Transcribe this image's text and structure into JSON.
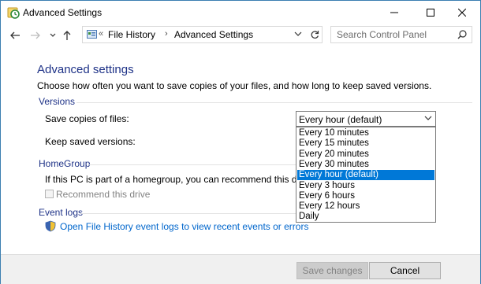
{
  "window": {
    "title": "Advanced Settings"
  },
  "address": {
    "crumbs": [
      "File History",
      "Advanced Settings"
    ],
    "overflow": "«",
    "separator": "›"
  },
  "search": {
    "placeholder": "Search Control Panel"
  },
  "main": {
    "heading": "Advanced settings",
    "description": "Choose how often you want to save copies of your files, and how long to keep saved versions.",
    "versions": {
      "group_label": "Versions",
      "save_copies_label": "Save copies of files:",
      "keep_versions_label": "Keep saved versions:",
      "save_copies_value": "Every hour (default)",
      "options": [
        "Every 10 minutes",
        "Every 15 minutes",
        "Every 20 minutes",
        "Every 30 minutes",
        "Every hour (default)",
        "Every 3 hours",
        "Every 6 hours",
        "Every 12 hours",
        "Daily"
      ],
      "selected_index": 4
    },
    "homegroup": {
      "group_label": "HomeGroup",
      "text": "If this PC is part of a homegroup, you can recommend this drive to",
      "checkbox_label": "Recommend this drive",
      "checked": false
    },
    "eventlogs": {
      "group_label": "Event logs",
      "link": "Open File History event logs to view recent events or errors"
    }
  },
  "footer": {
    "save_label": "Save changes",
    "cancel_label": "Cancel"
  },
  "colors": {
    "heading": "#1e3287",
    "link": "#0066cc",
    "selection": "#0078d7"
  }
}
